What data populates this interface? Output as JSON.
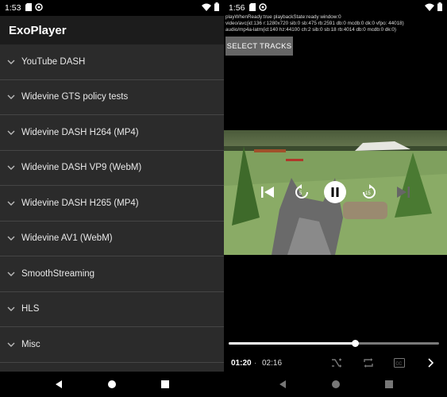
{
  "left": {
    "status": {
      "time": "1:53"
    },
    "app_title": "ExoPlayer",
    "items": [
      {
        "label": "YouTube DASH"
      },
      {
        "label": "Widevine GTS policy tests"
      },
      {
        "label": "Widevine DASH H264 (MP4)"
      },
      {
        "label": "Widevine DASH VP9 (WebM)"
      },
      {
        "label": "Widevine DASH H265 (MP4)"
      },
      {
        "label": "Widevine AV1 (WebM)"
      },
      {
        "label": "SmoothStreaming"
      },
      {
        "label": "HLS"
      },
      {
        "label": "Misc"
      }
    ]
  },
  "right": {
    "status": {
      "time": "1:56"
    },
    "debug_lines": [
      "playWhenReady:true playbackState:ready window:0",
      "video/avc(id:136 r:1280x720 sib:0 sb:475 rb:2591 db:0 mcdb:0 dk:0 vfpo: 44018)",
      "audio/mp4a-latm(id:140 hz:44100 ch:2 sib:0 sb:18 rb:4014 db:0 mcdb:0 dk:0)"
    ],
    "select_tracks_label": "SELECT TRACKS",
    "position": "01:20",
    "separator": "·",
    "duration": "02:16",
    "progress_fraction": 0.6
  },
  "icons": {
    "status": [
      "sd-card-icon",
      "sync-icon",
      "wifi-icon",
      "battery-icon"
    ],
    "nav": [
      "back-icon",
      "home-icon",
      "recents-icon"
    ]
  }
}
